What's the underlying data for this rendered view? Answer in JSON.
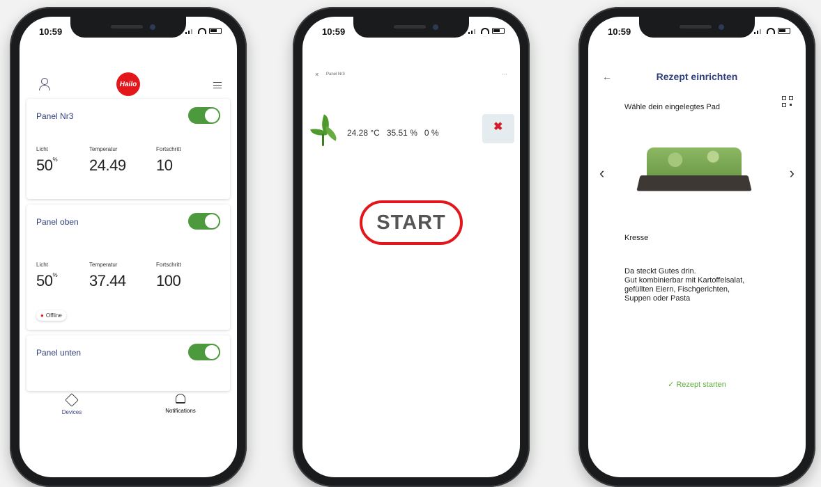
{
  "status": {
    "time": "10:59"
  },
  "phone1": {
    "logo": "Hailo",
    "panels": [
      {
        "name": "Panel Nr3",
        "metrics": [
          {
            "label": "Licht",
            "value": "50",
            "unit": "%"
          },
          {
            "label": "Temperatur",
            "value": "24.49",
            "unit": ""
          },
          {
            "label": "Fortschritt",
            "value": "10",
            "unit": ""
          }
        ],
        "on": true
      },
      {
        "name": "Panel oben",
        "metrics": [
          {
            "label": "Licht",
            "value": "50",
            "unit": "%"
          },
          {
            "label": "Temperatur",
            "value": "37.44",
            "unit": ""
          },
          {
            "label": "Fortschritt",
            "value": "100",
            "unit": ""
          }
        ],
        "badge": "Offline",
        "on": true
      },
      {
        "name": "Panel unten",
        "on": true
      }
    ],
    "tabs": [
      {
        "label": "Devices",
        "icon": "cube-icon"
      },
      {
        "label": "Notifications",
        "icon": "bell-icon"
      }
    ]
  },
  "phone2": {
    "title": "Panel Nr3",
    "readouts": [
      {
        "value": "24.28 °C"
      },
      {
        "value": "35.51 %"
      },
      {
        "value": "0 %"
      }
    ],
    "start_label": "START",
    "colors": {
      "accent": "#e3171b",
      "plant": "#4f9a2c"
    }
  },
  "phone3": {
    "back": "←",
    "title": "Rezept einrichten",
    "subtitle": "Wähle dein eingelegtes Pad",
    "prev": "‹",
    "next": "›",
    "name": "Kresse",
    "desc_lines": [
      "Da steckt Gutes drin.",
      "Gut kombinierbar mit Kartoffelsalat,",
      "gefüllten Eiern, Fischgerichten,",
      "Suppen oder Pasta"
    ],
    "start": "✓ Rezept starten",
    "colors": {
      "title": "#2d3e7a",
      "start": "#5fae3e"
    }
  }
}
